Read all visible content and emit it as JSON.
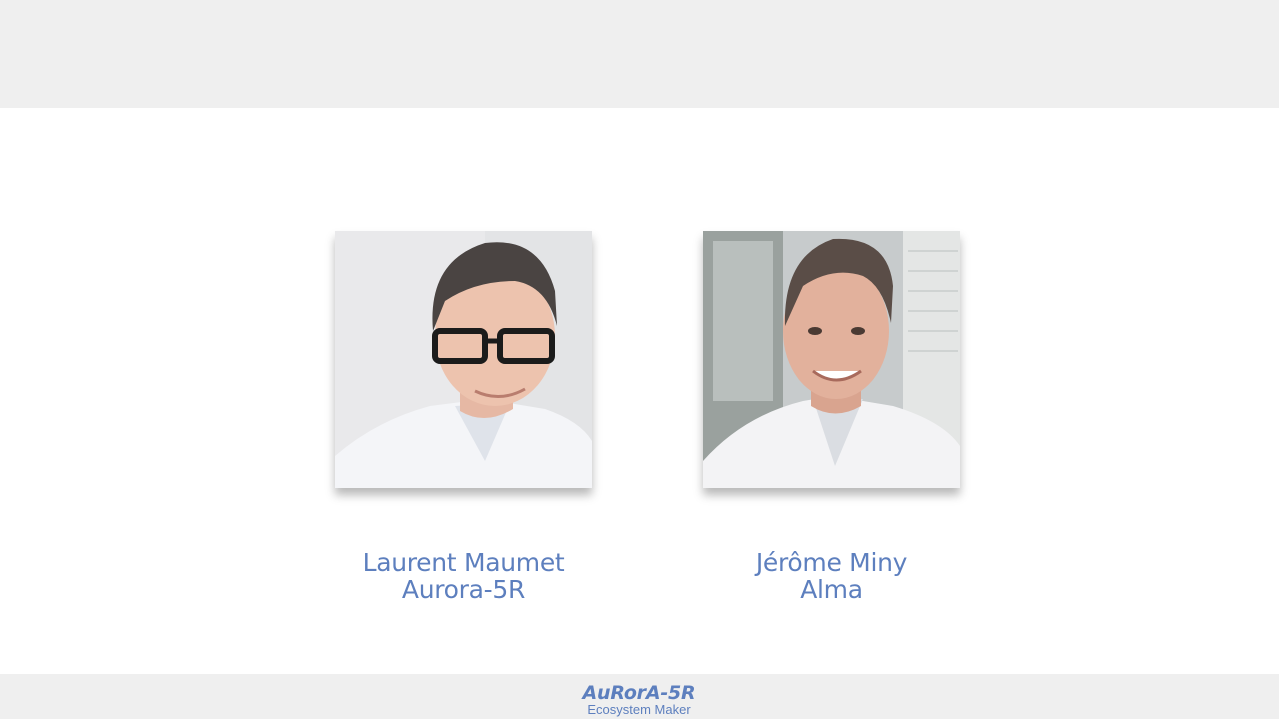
{
  "people": [
    {
      "name": "Laurent Maumet",
      "org": "Aurora-5R"
    },
    {
      "name": "Jérôme Miny",
      "org": "Alma"
    }
  ],
  "footer": {
    "logo_name": "AuRorA-5R",
    "logo_tagline": "Ecosystem Maker"
  },
  "colors": {
    "accent": "#5d7fbe",
    "band": "#efefef",
    "background": "#ffffff"
  }
}
